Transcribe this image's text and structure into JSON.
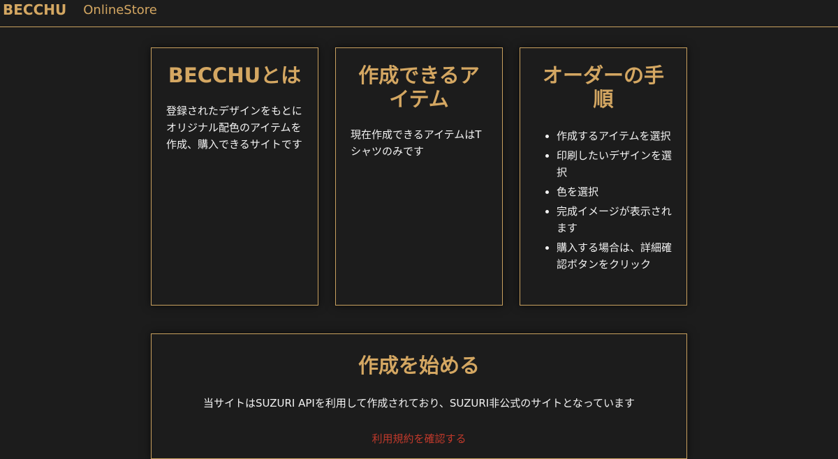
{
  "header": {
    "brand": "BECCHU",
    "nav_link": "OnlineStore"
  },
  "cards": [
    {
      "title": "BECCHUとは",
      "text": "登録されたデザインをもとにオリジナル配色のアイテムを作成、購入できるサイトです"
    },
    {
      "title": "作成できるアイテム",
      "text": "現在作成できるアイテムはTシャツのみです"
    },
    {
      "title": "オーダーの手順",
      "steps": [
        "作成するアイテムを選択",
        "印刷したいデザインを選択",
        "色を選択",
        "完成イメージが表示されます",
        "購入する場合は、詳細確認ボタンをクリック"
      ]
    }
  ],
  "start": {
    "title": "作成を始める",
    "text": "当サイトはSUZURI APIを利用して作成されており、SUZURI非公式のサイトとなっています",
    "terms_link": "利用規約を確認する"
  },
  "colors": {
    "accent": "#d4a762",
    "background": "#1c1c1c",
    "link": "#c0392b"
  }
}
